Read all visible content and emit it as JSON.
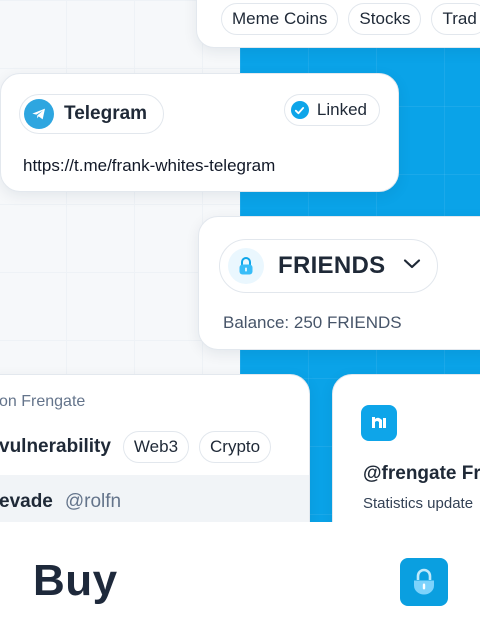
{
  "tags": [
    "Meme Coins",
    "Stocks",
    "Trad"
  ],
  "telegram": {
    "label": "Telegram",
    "status": "Linked",
    "url": "https://t.me/frank-whites-telegram"
  },
  "token": {
    "name": "FRIENDS",
    "balance": "Balance: 250 FRIENDS"
  },
  "post": {
    "subtitle": "on Frengate",
    "title": "vulnerability",
    "chips": [
      "Web3",
      "Crypto"
    ],
    "author_name": "evade",
    "author_handle": "@rolfn"
  },
  "profile": {
    "handle": "@frengate Fr",
    "stats": "Statistics update"
  },
  "footer": {
    "title": "Buy"
  },
  "colors": {
    "accent": "#0aa3e8",
    "telegram": "#2ea6e0"
  }
}
